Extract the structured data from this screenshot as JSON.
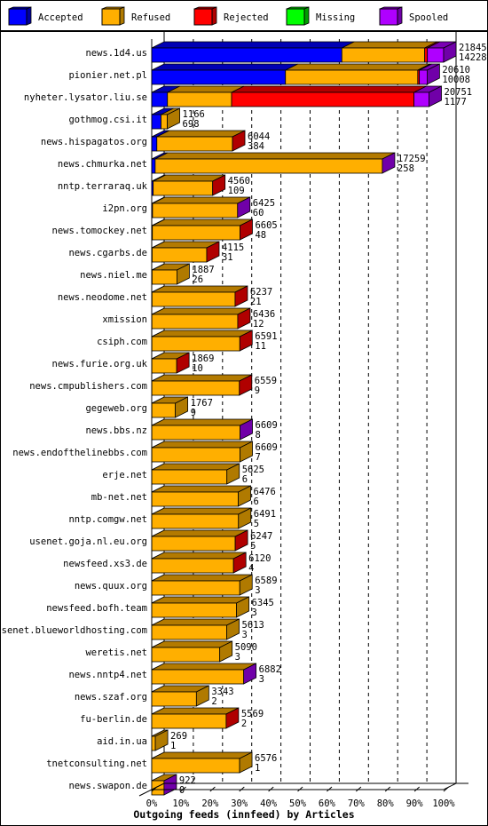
{
  "chart_data": {
    "type": "bar",
    "orientation": "horizontal",
    "stacked": true,
    "three_d": true,
    "title": "Outgoing feeds (innfeed) by Articles",
    "xlabel": "Outgoing feeds (innfeed) by Articles",
    "ylabel": "",
    "xlim": [
      0,
      100
    ],
    "x_unit": "%",
    "grid": true,
    "legend_position": "top",
    "x_ticks": [
      "0%",
      "10%",
      "20%",
      "30%",
      "40%",
      "50%",
      "60%",
      "70%",
      "80%",
      "90%",
      "100%"
    ],
    "max_total": 21845,
    "legend": [
      {
        "name": "Accepted",
        "color": "#0000ff",
        "side": "#0000a0"
      },
      {
        "name": "Refused",
        "color": "#ffaf00",
        "side": "#b07a00"
      },
      {
        "name": "Rejected",
        "color": "#ff0000",
        "side": "#b00000"
      },
      {
        "name": "Missing",
        "color": "#00ff00",
        "side": "#00a000"
      },
      {
        "name": "Spooled",
        "color": "#af00ff",
        "side": "#7000a8"
      }
    ],
    "categories": [
      "news.1d4.us",
      "pionier.net.pl",
      "nyheter.lysator.liu.se",
      "gothmog.csi.it",
      "news.hispagatos.org",
      "news.chmurka.net",
      "nntp.terraraq.uk",
      "i2pn.org",
      "news.tomockey.net",
      "news.cgarbs.de",
      "news.niel.me",
      "news.neodome.net",
      "xmission",
      "csiph.com",
      "news.furie.org.uk",
      "news.cmpublishers.com",
      "gegeweb.org",
      "news.bbs.nz",
      "news.endofthelinebbs.com",
      "erje.net",
      "mb-net.net",
      "nntp.comgw.net",
      "usenet.goja.nl.eu.org",
      "newsfeed.xs3.de",
      "news.quux.org",
      "newsfeed.bofh.team",
      "usenet.blueworldhosting.com",
      "weretis.net",
      "news.nntp4.net",
      "news.szaf.org",
      "fu-berlin.de",
      "aid.in.ua",
      "tnetconsulting.net",
      "news.swapon.de"
    ],
    "totals": [
      21845,
      20610,
      20751,
      1166,
      6044,
      17259,
      4560,
      6425,
      6605,
      4115,
      1887,
      6237,
      6436,
      6591,
      1869,
      6559,
      1767,
      6609,
      6609,
      5625,
      6476,
      6491,
      6247,
      6120,
      6589,
      6345,
      5613,
      5090,
      6882,
      3343,
      5569,
      269,
      6576,
      922
    ],
    "accepted_labels": [
      14228,
      10008,
      1177,
      698,
      384,
      258,
      109,
      60,
      48,
      31,
      26,
      21,
      12,
      11,
      10,
      9,
      9,
      8,
      7,
      6,
      6,
      5,
      5,
      4,
      3,
      3,
      3,
      3,
      3,
      2,
      2,
      1,
      1,
      0
    ],
    "series": [
      {
        "name": "Accepted",
        "values": [
          14228,
          10008,
          1177,
          698,
          384,
          258,
          109,
          60,
          48,
          31,
          26,
          21,
          12,
          11,
          10,
          9,
          9,
          8,
          7,
          6,
          6,
          5,
          5,
          4,
          3,
          3,
          3,
          3,
          3,
          2,
          2,
          1,
          1,
          0
        ]
      },
      {
        "name": "Refused",
        "values": [
          6200,
          9900,
          4800,
          468,
          5660,
          17001,
          4451,
          6365,
          6557,
          4084,
          1861,
          6216,
          6424,
          6580,
          1859,
          6550,
          1758,
          6601,
          6602,
          5619,
          6470,
          6486,
          6242,
          6116,
          6586,
          6342,
          5610,
          5087,
          6879,
          3341,
          5567,
          268,
          6575,
          922
        ]
      },
      {
        "name": "Rejected",
        "values": [
          200,
          120,
          13650,
          0,
          0,
          0,
          0,
          0,
          0,
          0,
          0,
          0,
          0,
          0,
          0,
          0,
          0,
          0,
          0,
          0,
          0,
          0,
          0,
          0,
          0,
          0,
          0,
          0,
          0,
          0,
          0,
          0,
          0,
          0
        ]
      },
      {
        "name": "Missing",
        "values": [
          0,
          0,
          0,
          0,
          0,
          0,
          0,
          0,
          0,
          0,
          0,
          0,
          0,
          0,
          0,
          0,
          0,
          0,
          0,
          0,
          0,
          0,
          0,
          0,
          0,
          0,
          0,
          0,
          0,
          0,
          0,
          0,
          0,
          0
        ]
      },
      {
        "name": "Spooled",
        "values": [
          1217,
          582,
          1124,
          0,
          0,
          0,
          0,
          0,
          0,
          0,
          0,
          0,
          0,
          0,
          0,
          0,
          0,
          0,
          0,
          0,
          0,
          0,
          0,
          0,
          0,
          0,
          0,
          0,
          0,
          0,
          0,
          0,
          0,
          0
        ]
      }
    ],
    "end_face": [
      "Spooled",
      "Spooled",
      "Spooled",
      "Refused",
      "Rejected",
      "Spooled",
      "Rejected",
      "Spooled",
      "Rejected",
      "Rejected",
      "Refused",
      "Rejected",
      "Rejected",
      "Rejected",
      "Rejected",
      "Rejected",
      "Refused",
      "Spooled",
      "Refused",
      "Refused",
      "Refused",
      "Refused",
      "Rejected",
      "Rejected",
      "Refused",
      "Refused",
      "Refused",
      "Refused",
      "Spooled",
      "Refused",
      "Rejected",
      "Refused",
      "Refused",
      "Spooled"
    ]
  }
}
